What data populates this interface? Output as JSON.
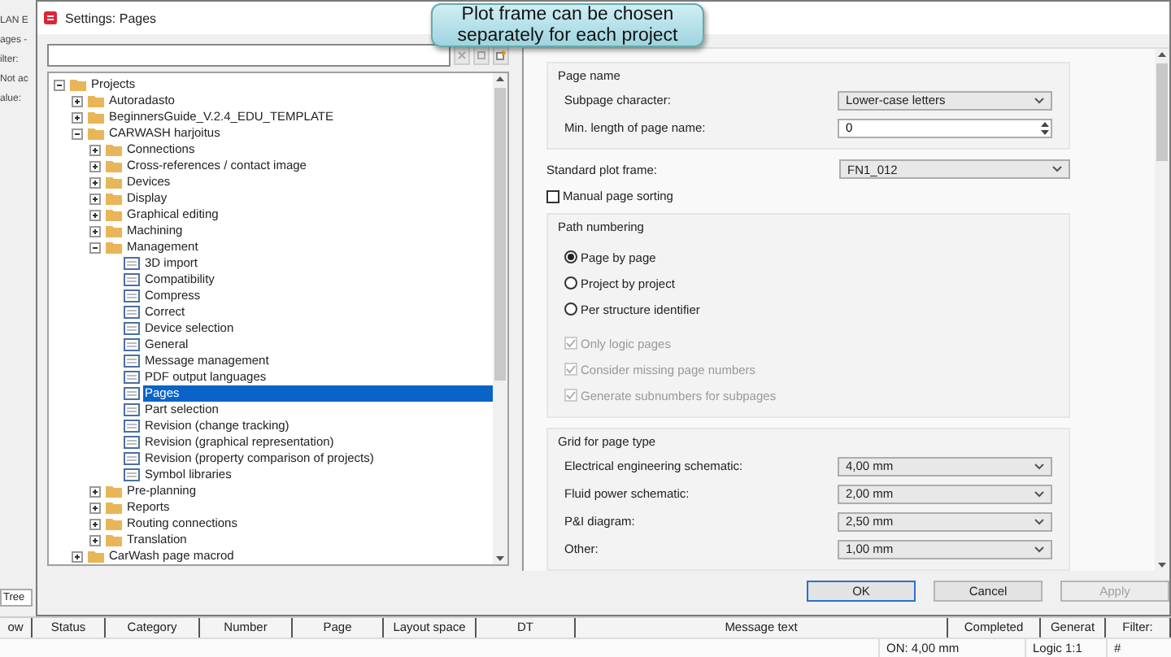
{
  "background_app": {
    "title": "LAN E",
    "items": [
      "ages -",
      "ilter:",
      "Not ac",
      "alue:"
    ],
    "tab": "Tree"
  },
  "window": {
    "title": "Settings: Pages"
  },
  "callout": {
    "text": "Plot frame can be chosen separately for each project"
  },
  "tree": [
    {
      "label": "Projects",
      "kind": "folder",
      "expanded": true,
      "selected": false,
      "children": [
        {
          "label": "Autoradasto",
          "kind": "folder",
          "expanded": false,
          "selected": false
        },
        {
          "label": "BeginnersGuide_V.2.4_EDU_TEMPLATE",
          "kind": "folder",
          "expanded": false,
          "selected": false
        },
        {
          "label": "CARWASH harjoitus",
          "kind": "folder",
          "expanded": true,
          "selected": false,
          "children": [
            {
              "label": "Connections",
              "kind": "folder",
              "expanded": false,
              "selected": false
            },
            {
              "label": "Cross-references / contact image",
              "kind": "folder",
              "expanded": false,
              "selected": false
            },
            {
              "label": "Devices",
              "kind": "folder",
              "expanded": false,
              "selected": false
            },
            {
              "label": "Display",
              "kind": "folder",
              "expanded": false,
              "selected": false
            },
            {
              "label": "Graphical editing",
              "kind": "folder",
              "expanded": false,
              "selected": false
            },
            {
              "label": "Machining",
              "kind": "folder",
              "expanded": false,
              "selected": false
            },
            {
              "label": "Management",
              "kind": "folder",
              "expanded": true,
              "selected": false,
              "children": [
                {
                  "label": "3D import",
                  "kind": "page",
                  "selected": false
                },
                {
                  "label": "Compatibility",
                  "kind": "page",
                  "selected": false
                },
                {
                  "label": "Compress",
                  "kind": "page",
                  "selected": false
                },
                {
                  "label": "Correct",
                  "kind": "page",
                  "selected": false
                },
                {
                  "label": "Device selection",
                  "kind": "page",
                  "selected": false
                },
                {
                  "label": "General",
                  "kind": "page",
                  "selected": false
                },
                {
                  "label": "Message management",
                  "kind": "page",
                  "selected": false
                },
                {
                  "label": "PDF output languages",
                  "kind": "page",
                  "selected": false
                },
                {
                  "label": "Pages",
                  "kind": "page",
                  "selected": true
                },
                {
                  "label": "Part selection",
                  "kind": "page",
                  "selected": false
                },
                {
                  "label": "Revision (change tracking)",
                  "kind": "page",
                  "selected": false
                },
                {
                  "label": "Revision (graphical representation)",
                  "kind": "page",
                  "selected": false
                },
                {
                  "label": "Revision (property comparison of projects)",
                  "kind": "page",
                  "selected": false
                },
                {
                  "label": "Symbol libraries",
                  "kind": "page",
                  "selected": false
                }
              ]
            },
            {
              "label": "Pre-planning",
              "kind": "folder",
              "expanded": false,
              "selected": false
            },
            {
              "label": "Reports",
              "kind": "folder",
              "expanded": false,
              "selected": false
            },
            {
              "label": "Routing connections",
              "kind": "folder",
              "expanded": false,
              "selected": false
            },
            {
              "label": "Translation",
              "kind": "folder",
              "expanded": false,
              "selected": false
            }
          ]
        },
        {
          "label": "CarWash page macrod",
          "kind": "folder",
          "expanded": false,
          "selected": false
        }
      ]
    }
  ],
  "page_name": {
    "title": "Page name",
    "fields": [
      {
        "label": "Subpage character:",
        "kind": "dropdown",
        "value": "Lower-case letters"
      },
      {
        "label": "Min. length of page name:",
        "kind": "spinner",
        "value": "0"
      }
    ]
  },
  "standard_plot_frame": {
    "label": "Standard plot frame:",
    "value": "FN1_012"
  },
  "manual_page_sorting": {
    "label": "Manual page sorting",
    "checked": false
  },
  "path_numbering": {
    "title": "Path numbering",
    "options": [
      {
        "label": "Page by page",
        "selected": true
      },
      {
        "label": "Project by project",
        "selected": false
      },
      {
        "label": "Per structure identifier",
        "selected": false
      }
    ],
    "checkboxes": [
      {
        "label": "Only logic pages",
        "checked": true,
        "disabled": true
      },
      {
        "label": "Consider missing page numbers",
        "checked": true,
        "disabled": true
      },
      {
        "label": "Generate subnumbers for subpages",
        "checked": true,
        "disabled": true
      }
    ]
  },
  "grid": {
    "title": "Grid for page type",
    "fields": [
      {
        "label": "Electrical engineering schematic:",
        "value": "4,00 mm"
      },
      {
        "label": "Fluid power schematic:",
        "value": "2,00 mm"
      },
      {
        "label": "P&I diagram:",
        "value": "2,50 mm"
      },
      {
        "label": "Other:",
        "value": "1,00 mm"
      }
    ]
  },
  "buttons": [
    {
      "label": "OK",
      "kind": "default",
      "disabled": false
    },
    {
      "label": "Cancel",
      "kind": "normal",
      "disabled": false
    },
    {
      "label": "Apply",
      "kind": "normal",
      "disabled": true
    }
  ],
  "message_columns": [
    "ow",
    "Status",
    "Category",
    "Number",
    "Page",
    "Layout space",
    "DT",
    "Message text",
    "Completed",
    "Generat",
    "Filter:"
  ],
  "status_bar": [
    "ON: 4,00 mm",
    "Logic 1:1",
    "#"
  ]
}
